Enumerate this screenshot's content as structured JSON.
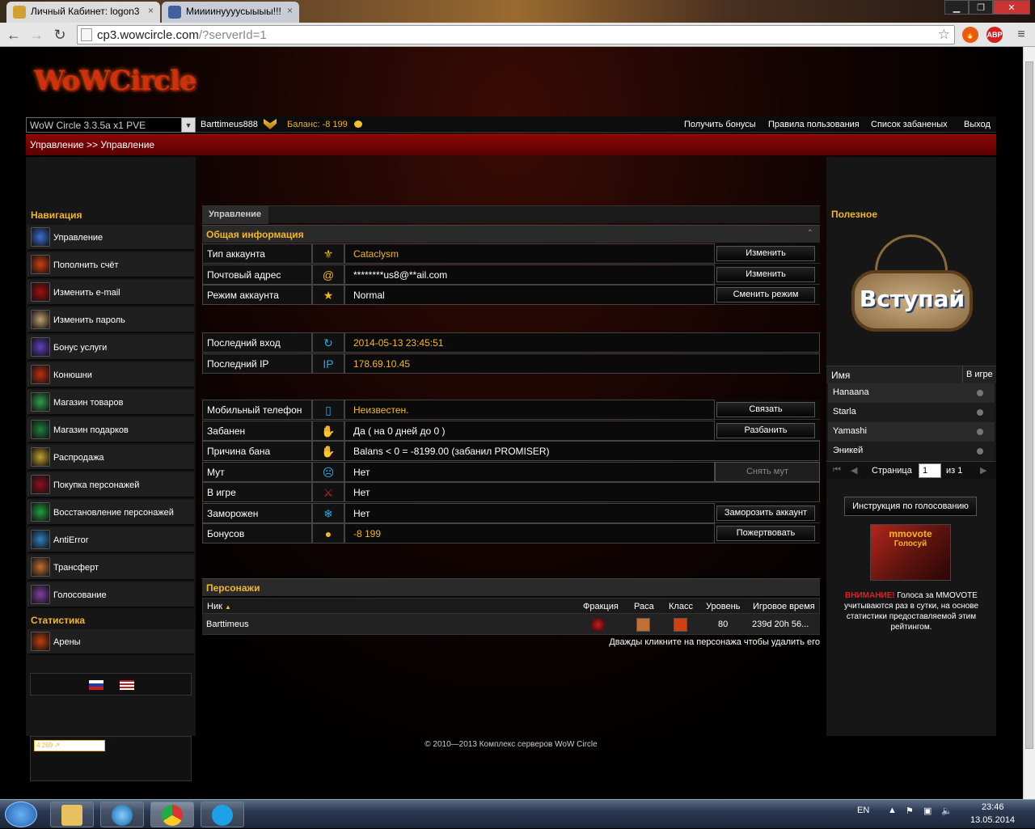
{
  "browser": {
    "tabs": [
      {
        "title": "Личный Кабинет: logon3"
      },
      {
        "title": "Миииинуууусыыыы!!!"
      }
    ],
    "url_host": "cp3.wowcircle.com",
    "url_path": "/?serverId=1",
    "ext_badge": "ABP",
    "ext_count": "2"
  },
  "site": {
    "logo": "WoWCircle",
    "realm": "WoW Circle 3.3.5a x1 PVE",
    "username": "Barttimeus888",
    "balance_label": "Баланс:",
    "balance_value": "-8 199",
    "links": [
      "Получить бонусы",
      "Правила пользования",
      "Список забаненых",
      "Выход"
    ],
    "breadcrumb": "Управление >> Управление"
  },
  "nav": {
    "header": "Навигация",
    "items": [
      {
        "label": "Управление",
        "color": "#3a6fd0"
      },
      {
        "label": "Пополнить счёт",
        "color": "#d04010"
      },
      {
        "label": "Изменить e-mail",
        "color": "#a01010"
      },
      {
        "label": "Изменить пароль",
        "color": "#c0a070"
      },
      {
        "label": "Бонус услуги",
        "color": "#6040c0"
      },
      {
        "label": "Конюшни",
        "color": "#c03010"
      },
      {
        "label": "Магазин товаров",
        "color": "#30a050"
      },
      {
        "label": "Магазин подарков",
        "color": "#208040"
      },
      {
        "label": "Распродажа",
        "color": "#c0a030"
      },
      {
        "label": "Покупка персонажей",
        "color": "#901020"
      },
      {
        "label": "Восстановление персонажей",
        "color": "#20a040"
      },
      {
        "label": "AntiError",
        "color": "#3080c0"
      },
      {
        "label": "Трансферт",
        "color": "#c07030"
      },
      {
        "label": "Голосование",
        "color": "#8040a0"
      }
    ],
    "stats_header": "Статистика",
    "stats_items": [
      {
        "label": "Арены",
        "color": "#c04010"
      }
    ],
    "counter": "4 269"
  },
  "main": {
    "section_title": "Управление",
    "general_title": "Общая информация",
    "rows1": [
      {
        "label": "Тип аккаунта",
        "icon": "wotlk-icon",
        "glyph": "⚜",
        "value": "Cataclysm",
        "gold": true,
        "button": "Изменить"
      },
      {
        "label": "Почтовый адрес",
        "icon": "at-icon",
        "glyph": "@",
        "value": "********us8@**ail.com",
        "gold": false,
        "button": "Изменить"
      },
      {
        "label": "Режим аккаунта",
        "icon": "star-icon",
        "glyph": "★",
        "value": "Normal",
        "gold": false,
        "button": "Сменить режим"
      }
    ],
    "rows2": [
      {
        "label": "Последний вход",
        "icon": "refresh-icon",
        "glyph": "↻",
        "value": "2014-05-13 23:45:51"
      },
      {
        "label": "Последний IP",
        "icon": "ip-icon",
        "glyph": "IP",
        "value": "178.69.10.45"
      }
    ],
    "rows3": [
      {
        "label": "Мобильный телефон",
        "icon": "phone-icon",
        "glyph": "▯",
        "value": "Неизвестен.",
        "gold": true,
        "button": "Связать"
      },
      {
        "label": "Забанен",
        "icon": "ban-icon",
        "glyph": "✋",
        "value": "Да ( на 0 дней до 0 )",
        "gold": false,
        "button": "Разбанить"
      },
      {
        "label": "Причина бана",
        "icon": "ban-reason-icon",
        "glyph": "✋",
        "value": "Balans < 0 = -8199.00 (забанил PROMISER)",
        "gold": false,
        "button": ""
      },
      {
        "label": "Мут",
        "icon": "mute-icon",
        "glyph": "☹",
        "value": "Нет",
        "gold": false,
        "button": "Снять мут",
        "disabled": true
      },
      {
        "label": "В игре",
        "icon": "ingame-icon",
        "glyph": "⚔",
        "value": "Нет",
        "gold": false,
        "button": ""
      },
      {
        "label": "Заморожен",
        "icon": "snowflake-icon",
        "glyph": "❄",
        "value": "Нет",
        "gold": false,
        "button": "Заморозить аккаунт"
      },
      {
        "label": "Бонусов",
        "icon": "coin-icon",
        "glyph": "●",
        "value": "-8 199",
        "gold": true,
        "button": "Пожертвовать"
      }
    ],
    "chars_title": "Персонажи",
    "chars_cols": [
      "Ник",
      "Фракция",
      "Раса",
      "Класс",
      "Уровень",
      "Игровое время"
    ],
    "chars": [
      {
        "name": "Barttimeus",
        "level": "80",
        "time": "239d 20h 56..."
      }
    ],
    "chars_hint": "Дважды кликните на персонажа чтобы удалить его"
  },
  "right": {
    "header": "Полезное",
    "vk_sign": "Вступай",
    "users_cols": [
      "Имя",
      "В игре"
    ],
    "users": [
      "Hanaana",
      "Starla",
      "Yamashi",
      "Эникей"
    ],
    "pager_label": "Страница",
    "pager_value": "1",
    "pager_of": "из 1",
    "instr_button": "Инструкция по голосованию",
    "mmo_title": "mmovote",
    "mmo_sub": "Голосуй",
    "warn": "ВНИМАНИЕ!",
    "warn_text": "Голоса за MMOVOTE учитываются раз в сутки, на основе статистики предоставляемой этим рейтингом."
  },
  "footer": "© 2010—2013 Комплекс серверов WoW Circle",
  "taskbar": {
    "lang": "EN",
    "time": "23:46",
    "date": "13.05.2014"
  }
}
